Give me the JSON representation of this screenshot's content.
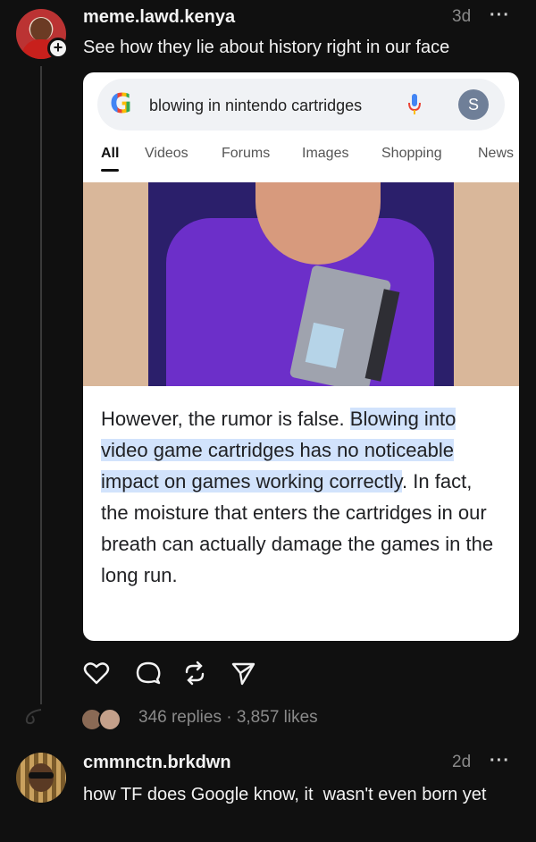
{
  "post": {
    "username": "meme.lawd.kenya",
    "time": "3d",
    "more": "···",
    "text": "See how they lie about history right in our face"
  },
  "card": {
    "search_logo": "G",
    "search_query": "blowing in nintendo cartridges",
    "profile_initial": "S",
    "tabs": [
      "All",
      "Videos",
      "Forums",
      "Images",
      "Shopping",
      "News"
    ],
    "active_tab": "All",
    "snippet": {
      "part1": "However, the rumor is false. ",
      "highlight": "Blowing into video game cartridges has no noticeable impact on games working correctly",
      "part2": ". In fact, the moisture that enters the cartridges in our breath can actually damage the games in the long run."
    }
  },
  "actions": {
    "icons": [
      "heart-icon",
      "comment-icon",
      "repost-icon",
      "share-icon"
    ],
    "stats": "346 replies · 3,857 likes"
  },
  "reply": {
    "username": "cmmnctn.brkdwn",
    "time": "2d",
    "more": "···",
    "text": "how TF does Google know, it  wasn't even born yet"
  },
  "colors": {
    "background": "#101010",
    "muted": "#8a8a8a",
    "highlight": "#d2e3fc"
  }
}
